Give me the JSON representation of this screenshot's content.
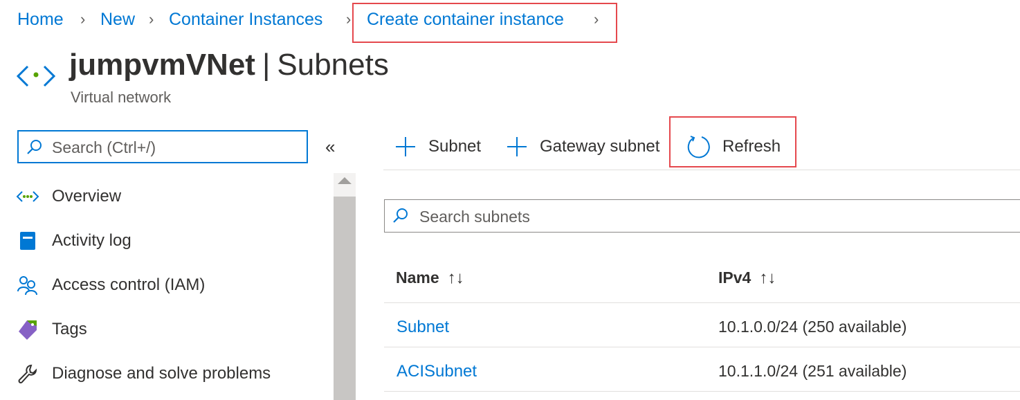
{
  "breadcrumb": {
    "items": [
      "Home",
      "New",
      "Container Instances",
      "Create container instance"
    ]
  },
  "header": {
    "resource_name": "jumpvmVNet",
    "separator": "|",
    "page": "Subnets",
    "subtitle": "Virtual network",
    "icon": "virtual-network-icon"
  },
  "sidebar": {
    "search_placeholder": "Search (Ctrl+/)",
    "collapse_glyph": "«",
    "items": [
      {
        "label": "Overview",
        "icon": "overview-icon"
      },
      {
        "label": "Activity log",
        "icon": "activity-log-icon"
      },
      {
        "label": "Access control (IAM)",
        "icon": "access-control-icon"
      },
      {
        "label": "Tags",
        "icon": "tag-icon"
      },
      {
        "label": "Diagnose and solve problems",
        "icon": "wrench-icon"
      }
    ]
  },
  "toolbar": {
    "add_subnet": "Subnet",
    "add_gateway_subnet": "Gateway subnet",
    "refresh": "Refresh"
  },
  "subnets": {
    "search_placeholder": "Search subnets",
    "columns": [
      "Name",
      "IPv4"
    ],
    "sort_glyph": "↑↓",
    "rows": [
      {
        "name": "Subnet",
        "ipv4": "10.1.0.0/24 (250 available)"
      },
      {
        "name": "ACISubnet",
        "ipv4": "10.1.1.0/24 (251 available)"
      }
    ]
  },
  "colors": {
    "link": "#0078d4",
    "highlight_box": "#e5484d",
    "text": "#323130"
  }
}
